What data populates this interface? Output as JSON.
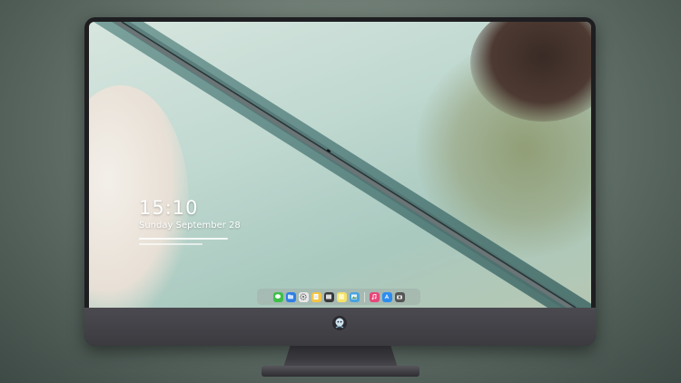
{
  "lock_screen": {
    "time": "15:10",
    "date": "Sunday September 28"
  },
  "dock": {
    "apps": [
      {
        "name": "messages-icon",
        "color": "#3fbf4a"
      },
      {
        "name": "files-icon",
        "color": "#2f7ee6"
      },
      {
        "name": "settings-icon",
        "color": "#e9e9e9"
      },
      {
        "name": "notes-icon",
        "color": "#f5c542"
      },
      {
        "name": "clapper-icon",
        "color": "#3a3a3a"
      },
      {
        "name": "sticky-icon",
        "color": "#f4e36a"
      },
      {
        "name": "preview-icon",
        "color": "#4aa3df"
      },
      {
        "name": "music-icon",
        "color": "#e8457a"
      },
      {
        "name": "app-store-icon",
        "color": "#2d8cf0"
      },
      {
        "name": "camera-icon",
        "color": "#555555"
      }
    ]
  }
}
